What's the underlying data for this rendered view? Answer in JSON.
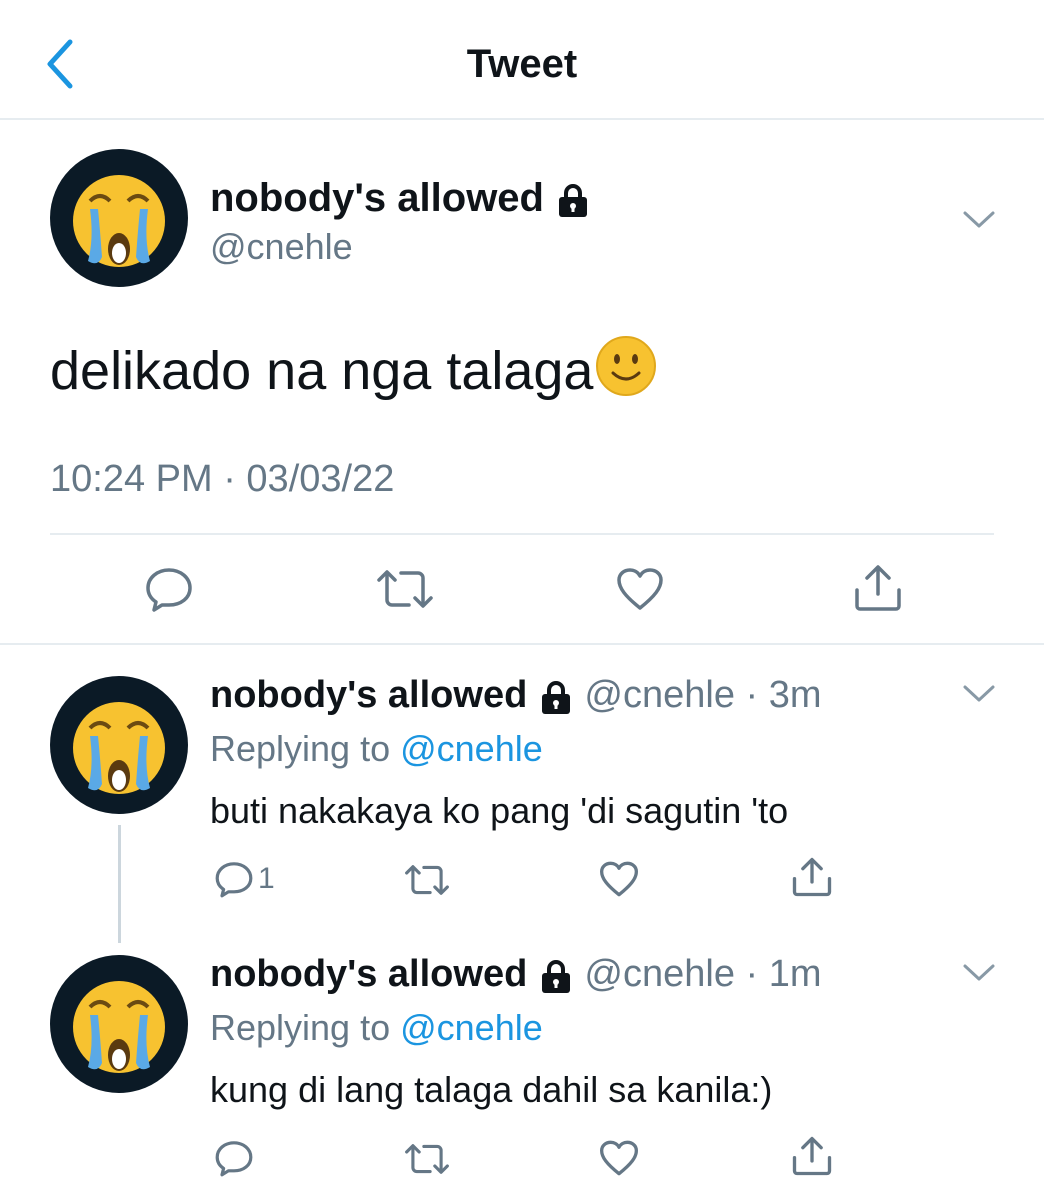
{
  "header": {
    "title": "Tweet",
    "back_icon": "chevron-left-icon"
  },
  "main_tweet": {
    "display_name": "nobody's allowed",
    "handle": "@cnehle",
    "text": "delikado na nga talaga",
    "emoji": "slightly-smiling-face",
    "time": "10:24 PM · 03/03/22",
    "actions": [
      "reply-icon",
      "retweet-icon",
      "like-icon",
      "share-icon"
    ]
  },
  "replies": [
    {
      "display_name": "nobody's allowed",
      "handle_time": "@cnehle · 3m",
      "replying_prefix": "Replying to ",
      "replying_to": "@cnehle",
      "text": "buti nakakaya ko pang 'di sagutin 'to",
      "reply_count": "1"
    },
    {
      "display_name": "nobody's allowed",
      "handle_time": "@cnehle · 1m",
      "replying_prefix": "Replying to ",
      "replying_to": "@cnehle",
      "text": "kung di lang talaga dahil sa kanila:)",
      "reply_count": ""
    }
  ],
  "colors": {
    "accent": "#1b95e0",
    "secondary_text": "#657786",
    "divider": "#e6ecf0"
  }
}
